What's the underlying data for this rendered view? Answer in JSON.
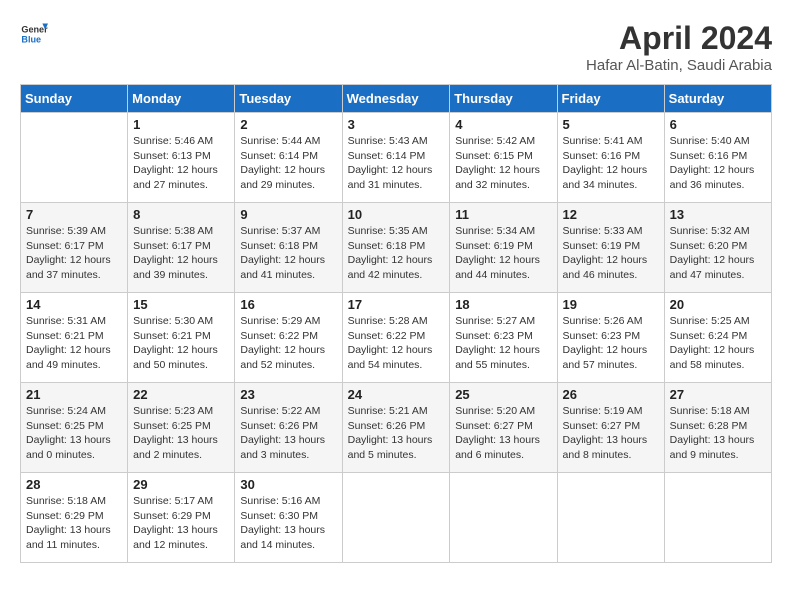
{
  "header": {
    "logo_line1": "General",
    "logo_line2": "Blue",
    "title": "April 2024",
    "subtitle": "Hafar Al-Batin, Saudi Arabia"
  },
  "calendar": {
    "days_of_week": [
      "Sunday",
      "Monday",
      "Tuesday",
      "Wednesday",
      "Thursday",
      "Friday",
      "Saturday"
    ],
    "weeks": [
      [
        {
          "day": "",
          "info": ""
        },
        {
          "day": "1",
          "info": "Sunrise: 5:46 AM\nSunset: 6:13 PM\nDaylight: 12 hours\nand 27 minutes."
        },
        {
          "day": "2",
          "info": "Sunrise: 5:44 AM\nSunset: 6:14 PM\nDaylight: 12 hours\nand 29 minutes."
        },
        {
          "day": "3",
          "info": "Sunrise: 5:43 AM\nSunset: 6:14 PM\nDaylight: 12 hours\nand 31 minutes."
        },
        {
          "day": "4",
          "info": "Sunrise: 5:42 AM\nSunset: 6:15 PM\nDaylight: 12 hours\nand 32 minutes."
        },
        {
          "day": "5",
          "info": "Sunrise: 5:41 AM\nSunset: 6:16 PM\nDaylight: 12 hours\nand 34 minutes."
        },
        {
          "day": "6",
          "info": "Sunrise: 5:40 AM\nSunset: 6:16 PM\nDaylight: 12 hours\nand 36 minutes."
        }
      ],
      [
        {
          "day": "7",
          "info": "Sunrise: 5:39 AM\nSunset: 6:17 PM\nDaylight: 12 hours\nand 37 minutes."
        },
        {
          "day": "8",
          "info": "Sunrise: 5:38 AM\nSunset: 6:17 PM\nDaylight: 12 hours\nand 39 minutes."
        },
        {
          "day": "9",
          "info": "Sunrise: 5:37 AM\nSunset: 6:18 PM\nDaylight: 12 hours\nand 41 minutes."
        },
        {
          "day": "10",
          "info": "Sunrise: 5:35 AM\nSunset: 6:18 PM\nDaylight: 12 hours\nand 42 minutes."
        },
        {
          "day": "11",
          "info": "Sunrise: 5:34 AM\nSunset: 6:19 PM\nDaylight: 12 hours\nand 44 minutes."
        },
        {
          "day": "12",
          "info": "Sunrise: 5:33 AM\nSunset: 6:19 PM\nDaylight: 12 hours\nand 46 minutes."
        },
        {
          "day": "13",
          "info": "Sunrise: 5:32 AM\nSunset: 6:20 PM\nDaylight: 12 hours\nand 47 minutes."
        }
      ],
      [
        {
          "day": "14",
          "info": "Sunrise: 5:31 AM\nSunset: 6:21 PM\nDaylight: 12 hours\nand 49 minutes."
        },
        {
          "day": "15",
          "info": "Sunrise: 5:30 AM\nSunset: 6:21 PM\nDaylight: 12 hours\nand 50 minutes."
        },
        {
          "day": "16",
          "info": "Sunrise: 5:29 AM\nSunset: 6:22 PM\nDaylight: 12 hours\nand 52 minutes."
        },
        {
          "day": "17",
          "info": "Sunrise: 5:28 AM\nSunset: 6:22 PM\nDaylight: 12 hours\nand 54 minutes."
        },
        {
          "day": "18",
          "info": "Sunrise: 5:27 AM\nSunset: 6:23 PM\nDaylight: 12 hours\nand 55 minutes."
        },
        {
          "day": "19",
          "info": "Sunrise: 5:26 AM\nSunset: 6:23 PM\nDaylight: 12 hours\nand 57 minutes."
        },
        {
          "day": "20",
          "info": "Sunrise: 5:25 AM\nSunset: 6:24 PM\nDaylight: 12 hours\nand 58 minutes."
        }
      ],
      [
        {
          "day": "21",
          "info": "Sunrise: 5:24 AM\nSunset: 6:25 PM\nDaylight: 13 hours\nand 0 minutes."
        },
        {
          "day": "22",
          "info": "Sunrise: 5:23 AM\nSunset: 6:25 PM\nDaylight: 13 hours\nand 2 minutes."
        },
        {
          "day": "23",
          "info": "Sunrise: 5:22 AM\nSunset: 6:26 PM\nDaylight: 13 hours\nand 3 minutes."
        },
        {
          "day": "24",
          "info": "Sunrise: 5:21 AM\nSunset: 6:26 PM\nDaylight: 13 hours\nand 5 minutes."
        },
        {
          "day": "25",
          "info": "Sunrise: 5:20 AM\nSunset: 6:27 PM\nDaylight: 13 hours\nand 6 minutes."
        },
        {
          "day": "26",
          "info": "Sunrise: 5:19 AM\nSunset: 6:27 PM\nDaylight: 13 hours\nand 8 minutes."
        },
        {
          "day": "27",
          "info": "Sunrise: 5:18 AM\nSunset: 6:28 PM\nDaylight: 13 hours\nand 9 minutes."
        }
      ],
      [
        {
          "day": "28",
          "info": "Sunrise: 5:18 AM\nSunset: 6:29 PM\nDaylight: 13 hours\nand 11 minutes."
        },
        {
          "day": "29",
          "info": "Sunrise: 5:17 AM\nSunset: 6:29 PM\nDaylight: 13 hours\nand 12 minutes."
        },
        {
          "day": "30",
          "info": "Sunrise: 5:16 AM\nSunset: 6:30 PM\nDaylight: 13 hours\nand 14 minutes."
        },
        {
          "day": "",
          "info": ""
        },
        {
          "day": "",
          "info": ""
        },
        {
          "day": "",
          "info": ""
        },
        {
          "day": "",
          "info": ""
        }
      ]
    ]
  }
}
